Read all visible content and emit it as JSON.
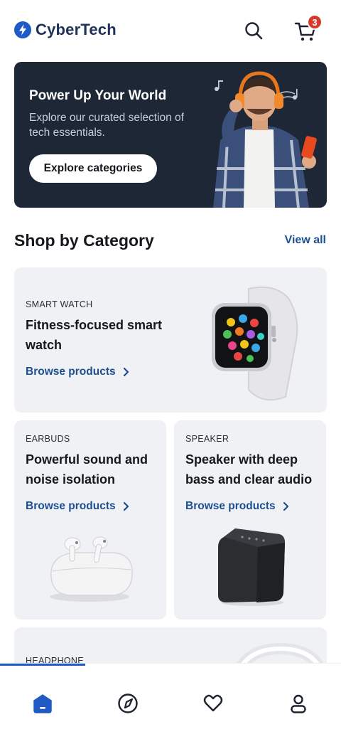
{
  "header": {
    "brand": "CyberTech",
    "cart_count": "3",
    "icons": [
      "bolt-logo-icon",
      "search-icon",
      "cart-icon"
    ]
  },
  "hero": {
    "title": "Power Up Your World",
    "subtitle": "Explore our curated selection of tech essentials.",
    "cta_label": "Explore categories"
  },
  "section": {
    "title": "Shop by Category",
    "view_all": "View all"
  },
  "categories": [
    {
      "category": "SMART WATCH",
      "title": "Fitness-focused smart watch",
      "link": "Browse products"
    },
    {
      "category": "EARBUDS",
      "title": "Powerful sound and noise isolation",
      "link": "Browse products"
    },
    {
      "category": "SPEAKER",
      "title": "Speaker with deep bass and clear audio",
      "link": "Browse products"
    },
    {
      "category": "HEADPHONE"
    }
  ],
  "bottom_nav": {
    "items": [
      "home-icon",
      "compass-icon",
      "heart-icon",
      "profile-icon"
    ],
    "active": "home-icon"
  },
  "colors": {
    "brand": "#1f5bc7",
    "link": "#1d4f91",
    "hero_bg": "#1d2735",
    "badge": "#d43a2b",
    "card_bg": "#f0f1f4"
  }
}
